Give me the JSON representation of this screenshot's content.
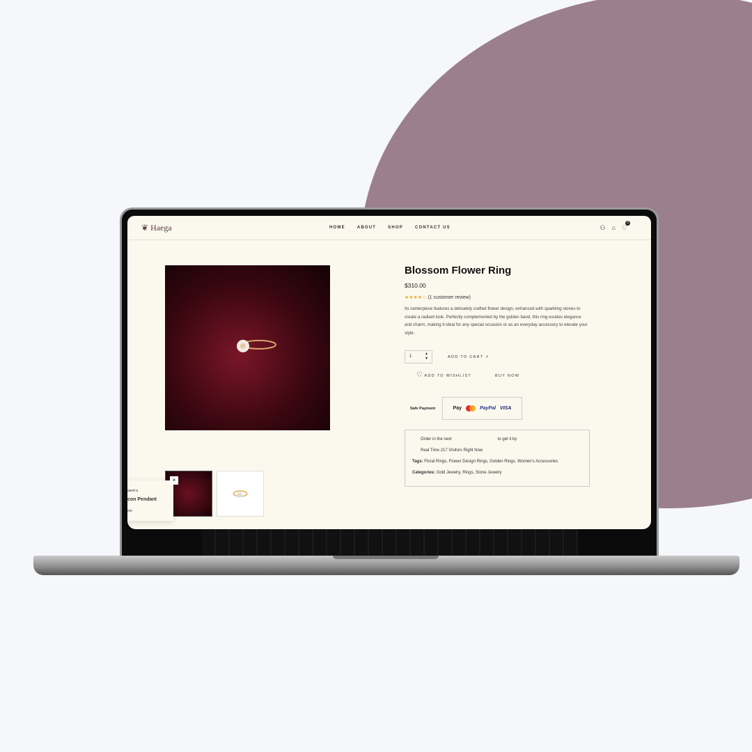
{
  "brand": {
    "logo": "Haega"
  },
  "nav": {
    "items": [
      "HOME",
      "ABOUT",
      "SHOP",
      "CONTACT US"
    ],
    "cart_count": "0"
  },
  "product": {
    "title": "Blossom Flower Ring",
    "price": "$310.00",
    "rating": 4,
    "rating_max": 5,
    "review_text": "(1 customer review)",
    "description": "Its centerpiece features a delicately crafted flower design, enhanced with sparkling stones to create a radiant look. Perfectly complemented by the golden band, this ring exudes elegance and charm, making it ideal for any special occasion or as an everyday accessory to elevate your style.",
    "quantity": "1",
    "add_to_cart": "ADD TO CART",
    "add_to_wishlist": "ADD TO WISHLIST",
    "buy_now": "BUY NOW"
  },
  "payment": {
    "label": "Safe Payment",
    "methods": [
      "Pay",
      "PayPal",
      "VISA"
    ]
  },
  "info": {
    "order_prefix": "Order in the next",
    "order_suffix": "to get it by",
    "visitors": "Real Time  217  Visitors Right Now",
    "tags_label": "Tags:",
    "tags": "Floral Rings, Flower Design Rings, Golden Rings, Women's Accessories",
    "categories_label": "Categories:",
    "categories": "Gold Jewelry, Rings, Stone Jewelry"
  },
  "popup": {
    "line1": "ased a",
    "line2": "con Pendant",
    "line3": "om",
    "close": "×"
  },
  "colors": {
    "background": "#f5f7fa",
    "blob": "#9c7f8c",
    "page": "#fbf8ee",
    "star": "#e7a928"
  }
}
